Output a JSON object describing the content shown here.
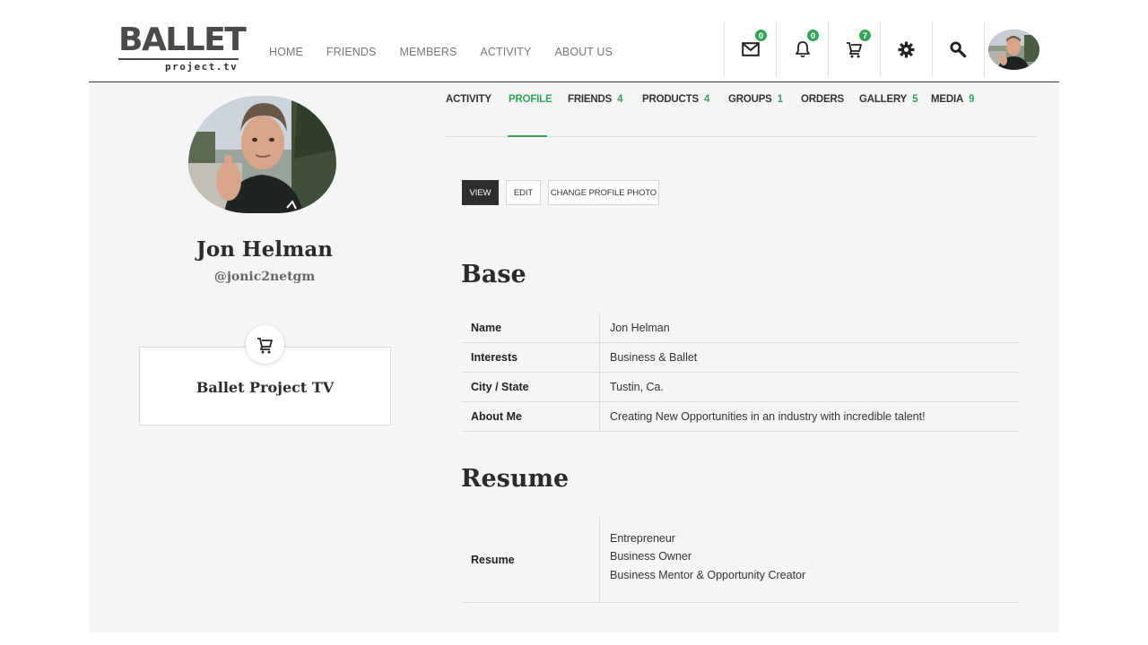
{
  "brand": {
    "logo_main": "BALLET",
    "logo_sub": "project.tv"
  },
  "nav": {
    "items": [
      "HOME",
      "FRIENDS",
      "MEMBERS",
      "ACTIVITY",
      "ABOUT US"
    ]
  },
  "header_icons": {
    "messages_count": "0",
    "notifications_count": "0",
    "cart_count": "7"
  },
  "profile": {
    "name": "Jon Helman",
    "handle": "@jonic2netgm",
    "store_name": "Ballet Project TV"
  },
  "tabs": [
    {
      "label": "ACTIVITY",
      "count": ""
    },
    {
      "label": "PROFILE",
      "count": ""
    },
    {
      "label": "FRIENDS",
      "count": "4"
    },
    {
      "label": "PRODUCTS",
      "count": "4"
    },
    {
      "label": "GROUPS",
      "count": "1"
    },
    {
      "label": "ORDERS",
      "count": ""
    },
    {
      "label": "GALLERY",
      "count": "5"
    },
    {
      "label": "MEDIA",
      "count": "9"
    }
  ],
  "sub_buttons": {
    "view": "VIEW",
    "edit": "EDIT",
    "change_photo": "CHANGE PROFILE PHOTO"
  },
  "base": {
    "title": "Base",
    "rows": [
      {
        "key": "Name",
        "value": "Jon Helman"
      },
      {
        "key": "Interests",
        "value": "Business & Ballet"
      },
      {
        "key": "City / State",
        "value": "Tustin, Ca."
      },
      {
        "key": "About Me",
        "value": "Creating New Opportunities in an industry with incredible talent!"
      }
    ]
  },
  "resume": {
    "title": "Resume",
    "key": "Resume",
    "lines": [
      "Entrepreneur",
      "Business Owner",
      "Business Mentor & Opportunity Creator"
    ]
  },
  "colors": {
    "accent": "#35a35a",
    "dark_button": "#2e2e2e",
    "panel_bg": "#f5f5f7"
  }
}
